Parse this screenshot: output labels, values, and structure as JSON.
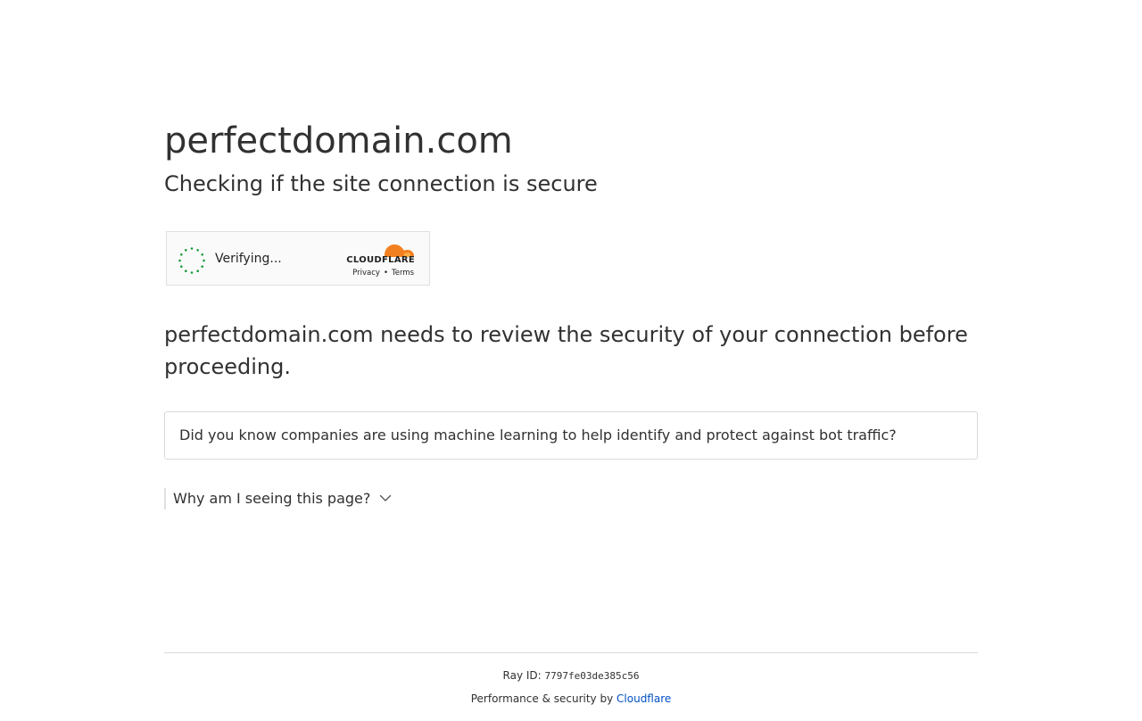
{
  "header": {
    "site_name": "perfectdomain.com",
    "subtitle": "Checking if the site connection is secure"
  },
  "widget": {
    "status_text": "Verifying...",
    "brand": "CLOUDFLARE",
    "privacy_label": "Privacy",
    "separator": "•",
    "terms_label": "Terms",
    "spinner_color": "#1a9b3c",
    "brand_color": "#f38020"
  },
  "main": {
    "lead_text": "perfectdomain.com needs to review the security of your connection before proceeding.",
    "tip_text": "Did you know companies are using machine learning to help identify and protect against bot traffic?",
    "why_label": "Why am I seeing this page?"
  },
  "footer": {
    "ray_label": "Ray ID:",
    "ray_value": "7797fe03de385c56",
    "perf_label": "Performance & security by",
    "cloudflare_link": "Cloudflare",
    "link_color": "#0051c3"
  }
}
